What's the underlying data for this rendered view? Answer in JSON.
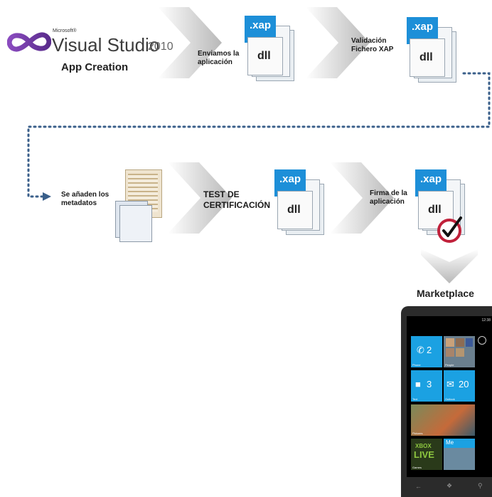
{
  "brand": {
    "microsoft": "Microsoft®",
    "product": "Visual Studio",
    "version": "2010",
    "subtitle": "App Creation"
  },
  "steps": {
    "send": {
      "line1": "Enviamos la",
      "line2": "aplicación"
    },
    "validate": {
      "line1": "Validación",
      "line2": "Fichero XAP"
    },
    "metadata": {
      "line1": "Se añaden los",
      "line2": "metadatos"
    },
    "test": {
      "line1": "TEST DE",
      "line2": "CERTIFICACIÓN"
    },
    "sign": {
      "line1": "Firma de la",
      "line2": "aplicación"
    }
  },
  "file": {
    "xap": ".xap",
    "dll": "dll"
  },
  "marketplace": "Marketplace",
  "phone": {
    "time": "12:38",
    "tiles": [
      {
        "num": "2",
        "name": "Phone"
      },
      {
        "num": "",
        "name": "People"
      },
      {
        "num": "3",
        "name": "Text"
      },
      {
        "num": "20",
        "name": "Outlook"
      },
      {
        "num": "",
        "name": "Pictures"
      },
      {
        "num": "",
        "name": "Games"
      },
      {
        "num": "Me",
        "name": ""
      }
    ],
    "xbox": "XBOX",
    "live": "LIVE"
  },
  "colors": {
    "xap_blue": "#1d8fd8",
    "phone_tile": "#1ba1e2",
    "flow_dots": "#3a5f8a",
    "arrow_grey": "#bdbdbd",
    "check_ring": "#c0203a"
  }
}
